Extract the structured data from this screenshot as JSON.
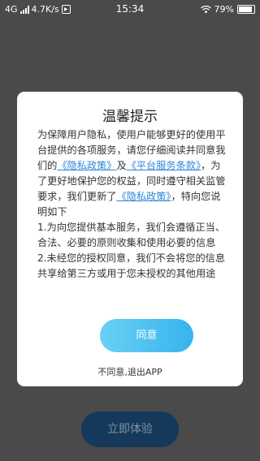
{
  "status_bar": {
    "network": "4G",
    "speed": "4.7K/s",
    "time": "15:34",
    "battery": "79%"
  },
  "dialog": {
    "title": "温馨提示",
    "p1_a": "为保障用户隐私，使用户能够更好的使用平台提供的各项服务，请您仔细阅读并同意我们的",
    "link_privacy_1": "《隐私政策》",
    "p1_b": "及",
    "link_service": "《平台服务条款》",
    "p1_c": "，为了更好地保护您的权益，同时遵守相关监管要求，我们更新了",
    "link_privacy_2": "《隐私政策》",
    "p1_d": "，特向您说明如下",
    "item1": "1.为向您提供基本服务，我们会遵循正当、合法、必要的原则收集和使用必要的信息",
    "item2": "2.未经您的授权同意，我们不会将您的信息共享给第三方或用于您未授权的其他用途",
    "agree_label": "同意",
    "decline_label": "不同意,退出APP"
  },
  "background": {
    "main_button_label": "立即体验"
  },
  "colors": {
    "overlay": "#4a4a4a",
    "link": "#2d86d8",
    "agree_gradient_start": "#6ad0f3",
    "agree_gradient_end": "#38b3ee"
  }
}
